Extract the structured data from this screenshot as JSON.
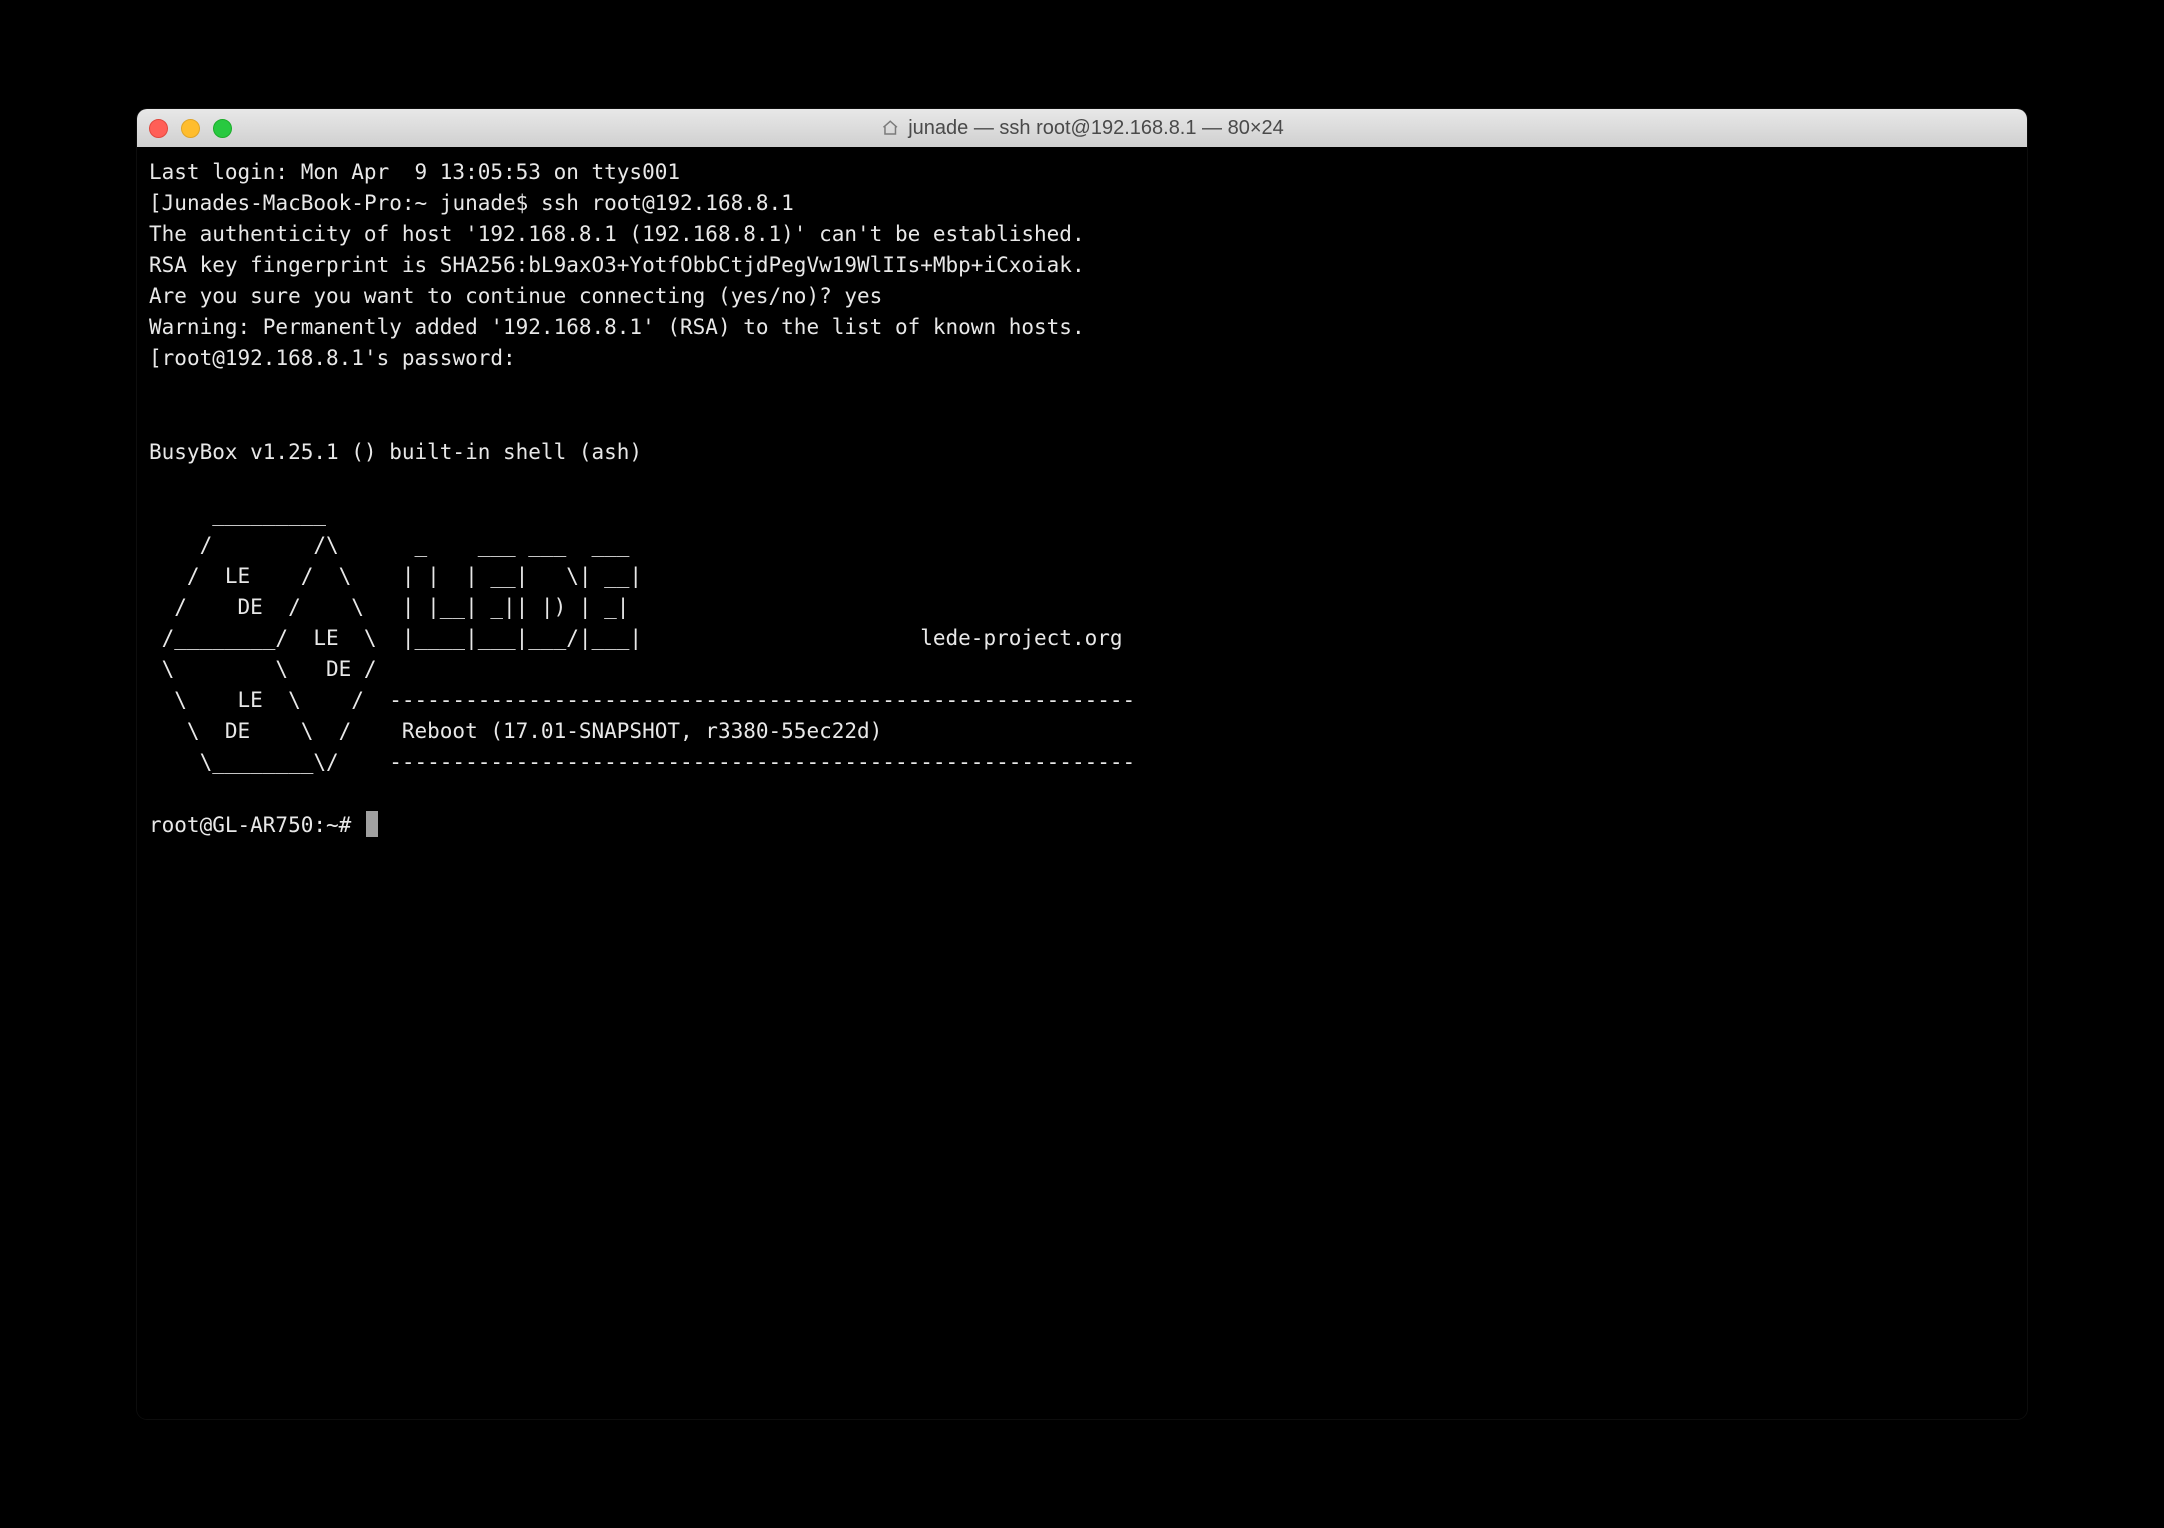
{
  "window": {
    "title": "junade — ssh root@192.168.8.1 — 80×24"
  },
  "terminal": {
    "line1": "Last login: Mon Apr  9 13:05:53 on ttys001",
    "line2_prefix": "[",
    "line2": "Junades-MacBook-Pro:~ junade$ ssh root@192.168.8.1",
    "line3": "The authenticity of host '192.168.8.1 (192.168.8.1)' can't be established.",
    "line4": "RSA key fingerprint is SHA256:bL9axO3+YotfObbCtjdPegVw19WlIIs+Mbp+iCxoiak.",
    "line5": "Are you sure you want to continue connecting (yes/no)? yes",
    "line6": "Warning: Permanently added '192.168.8.1' (RSA) to the list of known hosts.",
    "line7_prefix": "[",
    "line7": "root@192.168.8.1's password:",
    "blank1": "",
    "blank2": "",
    "busybox": "BusyBox v1.25.1 () built-in shell (ash)",
    "blank3": "",
    "art1": "     _________",
    "art2": "    /        /\\      _    ___ ___  ___",
    "art3": "   /  LE    /  \\    | |  | __|   \\| __|",
    "art4": "  /    DE  /    \\   | |__| _|| |) | _|",
    "art5": " /________/  LE  \\  |____|___|___/|___|                      lede-project.org",
    "art6": " \\        \\   DE /",
    "art7": "  \\    LE  \\    /  -----------------------------------------------------------",
    "art8": "   \\  DE    \\  /    Reboot (17.01-SNAPSHOT, r3380-55ec22d)",
    "art9": "    \\________\\/    -----------------------------------------------------------",
    "blank4": "",
    "prompt": "root@GL-AR750:~# "
  }
}
